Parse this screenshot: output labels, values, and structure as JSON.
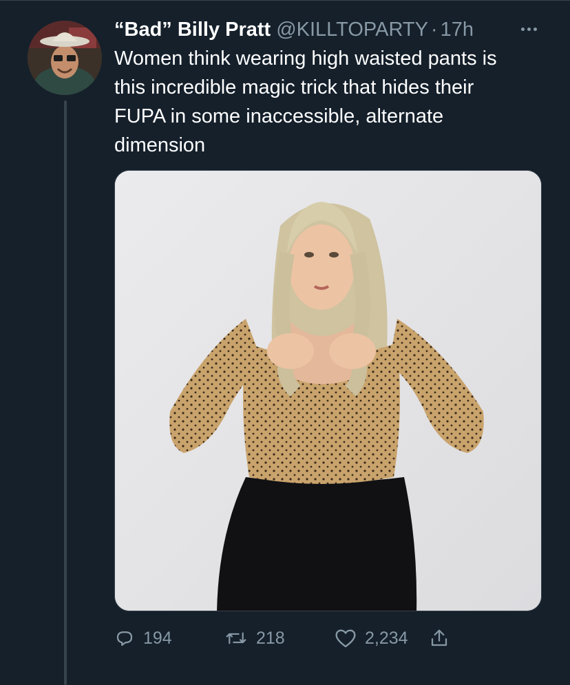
{
  "tweet": {
    "display_name": "“Bad” Billy Pratt",
    "handle": "@KILLTOPARTY",
    "separator": "·",
    "time": "17h",
    "text_lines": [
      "Women think wearing high waisted pants is",
      "this incredible magic trick that hides their",
      "FUPA in some inaccessible, alternate",
      "dimension"
    ]
  },
  "actions": {
    "replies": "194",
    "retweets": "218",
    "likes": "2,234"
  },
  "colors": {
    "background": "#15202b",
    "secondary_text": "#8899a6",
    "border": "#38444d"
  },
  "icons": [
    "more-icon",
    "reply-icon",
    "retweet-icon",
    "like-icon",
    "share-icon"
  ]
}
